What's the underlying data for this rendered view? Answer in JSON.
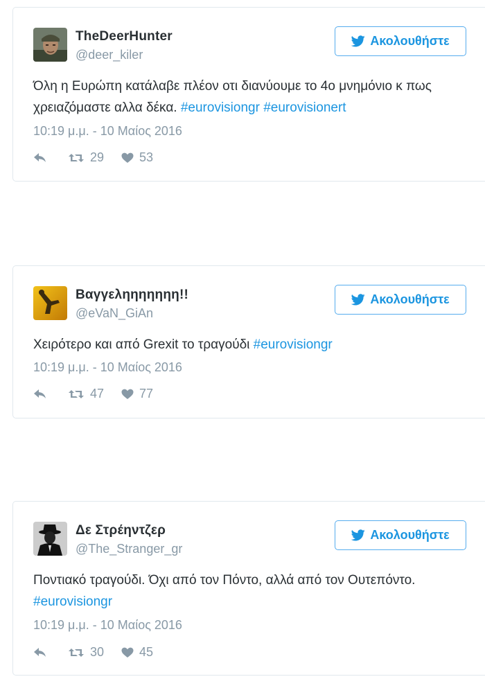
{
  "tweets": [
    {
      "name": "TheDeerHunter",
      "handle": "@deer_kiler",
      "follow_label": "Ακολουθήστε",
      "text_plain": "Όλη η Ευρώπη κατάλαβε πλέον οτι διανύουμε το 4ο μνημόνιο κ πως χρειαζόμαστε αλλα δέκα. ",
      "hashtags": [
        "#eurovisiongr",
        "#eurovisionert"
      ],
      "timestamp": "10:19 μ.μ. - 10 Μαίος 2016",
      "retweets": "29",
      "likes": "53"
    },
    {
      "name": "Βαγγεληηηηηηη!!",
      "handle": "@eVaN_GiAn",
      "follow_label": "Ακολουθήστε",
      "text_plain": "Χειρότερο και από Grexit το τραγούδι ",
      "hashtags": [
        "#eurovisiongr"
      ],
      "timestamp": "10:19 μ.μ. - 10 Μαίος 2016",
      "retweets": "47",
      "likes": "77"
    },
    {
      "name": "Δε Στρέηντζερ",
      "handle": "@The_Stranger_gr",
      "follow_label": "Ακολουθήστε",
      "text_plain": "Ποντιακό τραγούδι. Όχι από τον Πόντο, αλλά από τον Ουτεπόντο. ",
      "hashtags": [
        "#eurovisiongr"
      ],
      "timestamp": "10:19 μ.μ. - 10 Μαίος 2016",
      "retweets": "30",
      "likes": "45"
    }
  ],
  "colors": {
    "link": "#1b95e0",
    "muted": "#8899a6",
    "border": "#e1e8ed"
  }
}
